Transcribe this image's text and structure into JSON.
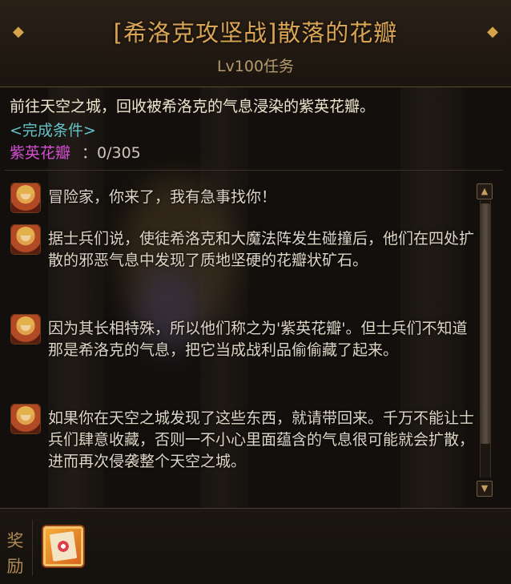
{
  "header": {
    "title": "[希洛克攻坚战]散落的花瓣",
    "subtitle": "Lv100任务",
    "left_icon": "diamond-ornament-icon",
    "right_icon": "diamond-ornament-icon"
  },
  "objective": {
    "text": "前往天空之城，回收被希洛克的气息浸染的紫英花瓣。",
    "condition_title": "<完成条件>",
    "item_name": "紫英花瓣",
    "item_count": "：0/305"
  },
  "dialogue": [
    {
      "speaker_icon": "npc-portrait-icon",
      "text": "冒险家，你来了，我有急事找你！"
    },
    {
      "speaker_icon": "npc-portrait-icon",
      "text": "据士兵们说，使徒希洛克和大魔法阵发生碰撞后，他们在四处扩散的邪恶气息中发现了质地坚硬的花瓣状矿石。"
    },
    {
      "speaker_icon": "npc-portrait-icon",
      "text": "因为其长相特殊，所以他们称之为'紫英花瓣'。但士兵们不知道那是希洛克的气息，把它当成战利品偷偷藏了起来。"
    },
    {
      "speaker_icon": "npc-portrait-icon",
      "text": "如果你在天空之城发现了这些东西，就请带回来。千万不能让士兵们肆意收藏，否则一不小心里面蕴含的气息很可能就会扩散，进而再次侵袭整个天空之城。"
    }
  ],
  "scrollbar": {
    "up_icon": "▲",
    "down_icon": "▼"
  },
  "reward": {
    "label": "奖励",
    "item_icon": "reward-box-icon"
  },
  "colors": {
    "title": "#d9a454",
    "condition": "#63c3c8",
    "item": "#d64fd2"
  }
}
